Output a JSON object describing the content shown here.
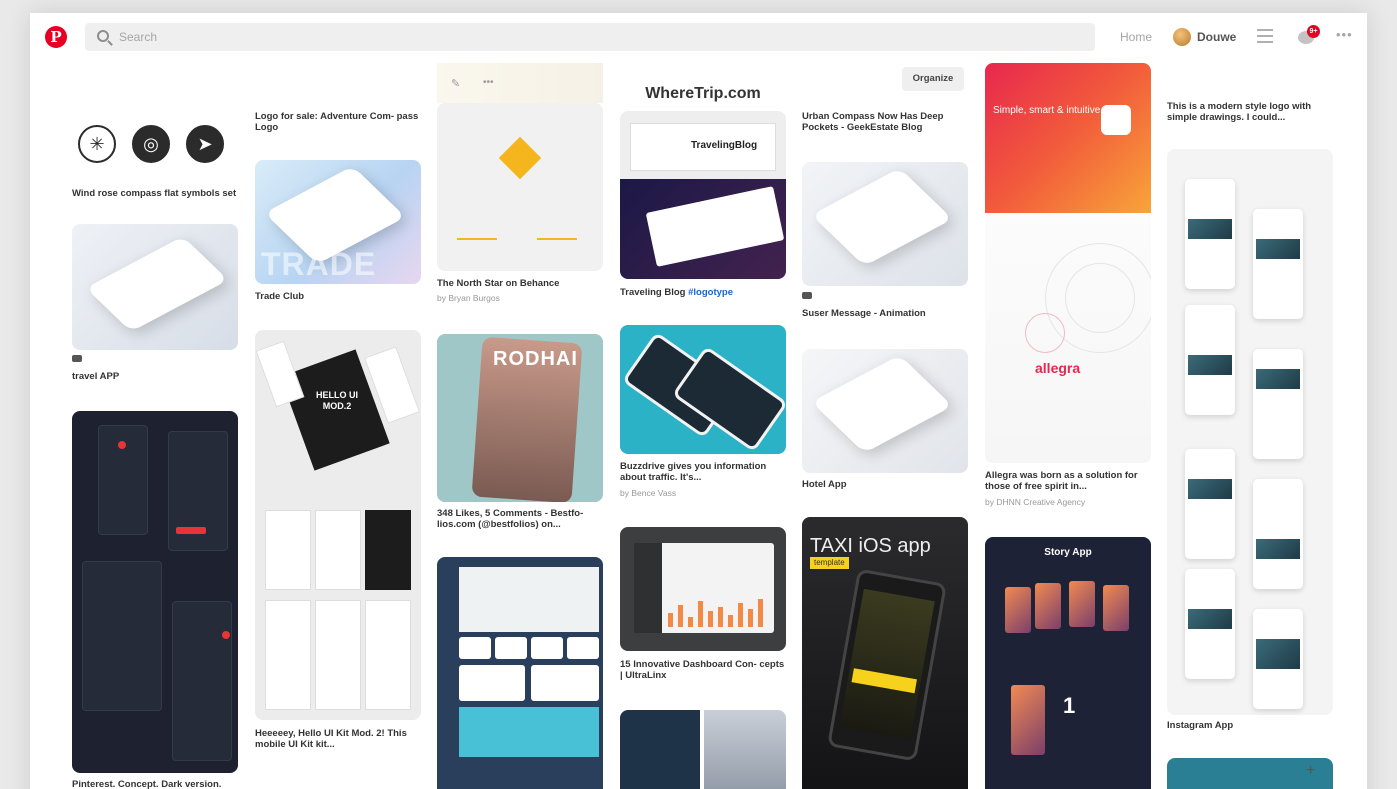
{
  "header": {
    "logo": "P",
    "search_placeholder": "Search",
    "home": "Home",
    "user_name": "Douwe",
    "notification_count": "9+",
    "more": "•••"
  },
  "col1": {
    "pin1_title": "Wind rose compass flat symbols set",
    "pin2_title": "travel APP",
    "pin3_title": "Pinterest. Concept. Dark version."
  },
  "col2": {
    "pin0_title": "Logo for sale: Adventure Com- pass Logo",
    "pin1_word": "TRADE",
    "pin1_title": "Trade Club",
    "pin2_image_text": "HELLO UI MOD.2",
    "pin2_title": "Heeeeey, Hello UI Kit Mod. 2! This mobile UI Kit kit..."
  },
  "col3": {
    "toolbar_more": "•••",
    "pin1_title": "The North Star on Behance",
    "pin1_sub": "by Bryan Burgos",
    "pin2_image_text": "RODHAI",
    "pin2_title": "348 Likes, 5 Comments - Bestfo- lios.com (@bestfolios) on..."
  },
  "col4": {
    "header_title": "WhereTrip.com",
    "pin1_image_text": "TravelingBlog",
    "pin1_title": "Traveling Blog",
    "pin1_hashtag": "#logotype",
    "pin2_title": "Buzzdrive gives you information about traffic. It's...",
    "pin2_sub": "by Bence Vass",
    "pin3_title": "15 Innovative Dashboard Con- cepts | UltraLinx"
  },
  "col5": {
    "organize": "Organize",
    "pin0_title": "Urban Compass Now Has Deep Pockets - GeekEstate Blog",
    "pin1_title": "Suser Message - Animation",
    "pin2_title": "Hotel App",
    "pin3_image_title": "TAXI iOS app",
    "pin3_image_tag": "template"
  },
  "col6": {
    "pin1_image_text": "Simple, smart & intuitive",
    "pin1_brand": "allegra",
    "pin1_title": "Allegra was born as a solution for those of free spirit in...",
    "pin1_sub": "by DHNN Creative Agency",
    "pin2_image_title": "Story App",
    "pin2_image_number": "1"
  },
  "col7": {
    "pin0_title": "This is a modern style logo with simple drawings. I could...",
    "pin1_title": "Instagram App",
    "add_icon": "+"
  },
  "colors": {
    "brand_red": "#e60023",
    "background": "#ffffff",
    "text": "#333333",
    "muted": "#999999",
    "link": "#1e62c9"
  }
}
